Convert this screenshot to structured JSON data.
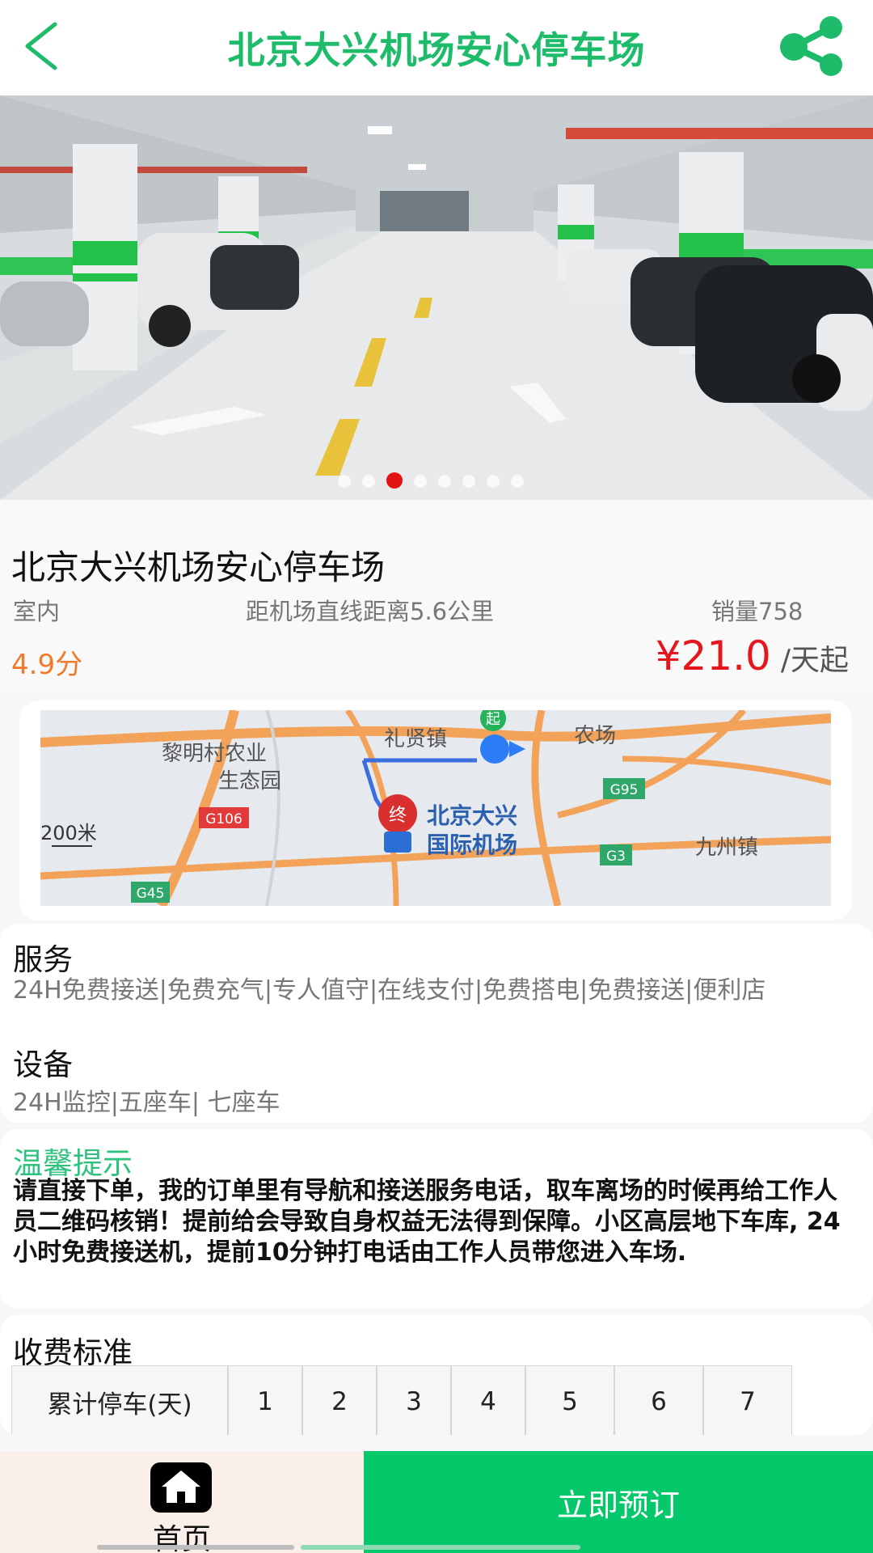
{
  "header": {
    "title": "北京大兴机场安心停车场",
    "back_icon": "chevron-left-icon",
    "share_icon": "share-icon",
    "accent_color": "#1ebc6a"
  },
  "carousel": {
    "total": 8,
    "active_index": 2,
    "active_color": "#e31212"
  },
  "lot": {
    "name": "北京大兴机场安心停车场",
    "type": "室内",
    "distance": "距机场直线距离5.6公里",
    "sales": "销量758",
    "rating": "4.9分",
    "price": "¥21.0",
    "price_unit": "/天起"
  },
  "map": {
    "labels": {
      "village": "黎明村农业",
      "village2": "生态园",
      "town1": "礼贤镇",
      "farm": "农场",
      "town2": "九州镇",
      "airport1": "北京大兴",
      "airport2": "国际机场",
      "scale": "200米",
      "start": "起",
      "end": "终"
    },
    "road_badges": [
      "G106",
      "G45",
      "G95",
      "G3"
    ]
  },
  "service": {
    "title": "服务",
    "items": "24H免费接送|免费充气|专人值守|在线支付|免费搭电|免费接送|便利店",
    "equipment_title": "设备",
    "equipment": "24H监控|五座车| 七座车"
  },
  "tips": {
    "title": "温馨提示",
    "text": "请直接下单，我的订单里有导航和接送服务电话，取车离场的时候再给工作人员二维码核销！提前给会导致自身权益无法得到保障。小区高层地下车库, 24小时免费接送机，提前10分钟打电话由工作人员带您进入车场."
  },
  "fee": {
    "title": "收费标准",
    "header_label": "累计停车(天)",
    "days": [
      "1",
      "2",
      "3",
      "4",
      "5",
      "6",
      "7"
    ]
  },
  "bottom": {
    "home_label": "首页",
    "home_icon": "home-icon",
    "book_label": "立即预订",
    "book_color": "#05c86a"
  }
}
